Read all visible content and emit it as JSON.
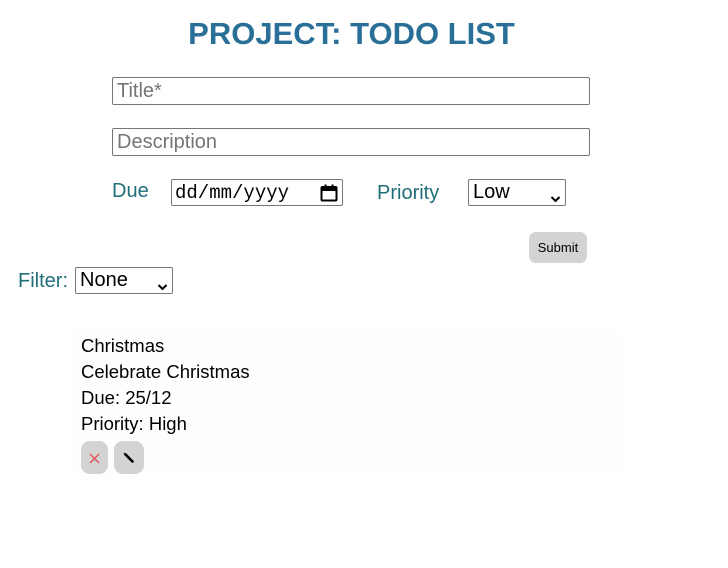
{
  "header": {
    "title": "PROJECT: TODO LIST"
  },
  "form": {
    "title_placeholder": "Title*",
    "description_placeholder": "Description",
    "due_label": "Due",
    "due_value": "dd/mm/yyyy",
    "priority_label": "Priority",
    "priority_value": "Low",
    "submit_label": "Submit"
  },
  "filter": {
    "label": "Filter:",
    "value": "None"
  },
  "todos": [
    {
      "title": "Christmas",
      "description": "Celebrate Christmas",
      "due": "Due: 25/12",
      "priority": "Priority: High",
      "delete_icon": "close-icon",
      "edit_icon": "pencil-icon"
    }
  ],
  "colors": {
    "title": "#2a6f97",
    "label": "#1f6f7a",
    "button_bg": "#d3d3d3",
    "delete_icon": "#e05050"
  }
}
